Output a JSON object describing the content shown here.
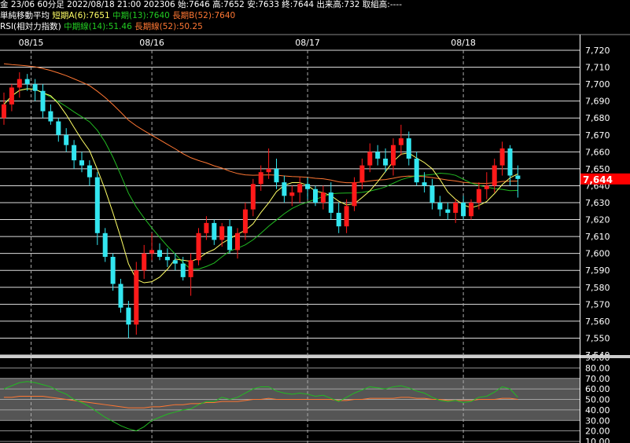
{
  "header": {
    "line1": "金 23/06 60分足 2022/08/18 21:00 202306 始:7646 高:7652 安:7633 終:7644 出来高:732 取組高:----",
    "line2_label": "単純移動平均",
    "ma_short": "短期A(6):7651",
    "ma_mid": "中期(13):7640",
    "ma_long": "長期B(52):7640",
    "line3_label": "RSI(相対力指数)",
    "rsi_mid": "中期線(14):51.46",
    "rsi_long": "長期線(52):50.25"
  },
  "colors": {
    "up": "#ff1a1a",
    "down": "#33e6f0",
    "ma_short": "#ffff66",
    "ma_mid": "#22bb22",
    "ma_long": "#ff7733",
    "last_price_bg": "#ff0000"
  },
  "last_price_label": "7,644",
  "chart_data": [
    {
      "type": "candlestick",
      "x_labels": [
        "08/15",
        "08/16",
        "08/17",
        "08/18"
      ],
      "x_label_index": [
        5,
        19,
        39,
        59
      ],
      "ylim": [
        7540,
        7720
      ],
      "yticks": [
        7540,
        7550,
        7560,
        7570,
        7580,
        7590,
        7600,
        7610,
        7620,
        7630,
        7640,
        7650,
        7660,
        7670,
        7680,
        7690,
        7700,
        7710,
        7720
      ],
      "candles": [
        [
          7680,
          7695,
          7676,
          7688
        ],
        [
          7688,
          7700,
          7684,
          7698
        ],
        [
          7698,
          7707,
          7692,
          7703
        ],
        [
          7703,
          7706,
          7696,
          7700
        ],
        [
          7700,
          7703,
          7690,
          7696
        ],
        [
          7696,
          7700,
          7680,
          7684
        ],
        [
          7684,
          7688,
          7676,
          7678
        ],
        [
          7678,
          7680,
          7666,
          7670
        ],
        [
          7670,
          7674,
          7660,
          7664
        ],
        [
          7664,
          7667,
          7650,
          7655
        ],
        [
          7655,
          7660,
          7648,
          7652
        ],
        [
          7652,
          7655,
          7640,
          7645
        ],
        [
          7645,
          7648,
          7605,
          7612
        ],
        [
          7612,
          7615,
          7595,
          7598
        ],
        [
          7598,
          7600,
          7578,
          7582
        ],
        [
          7582,
          7585,
          7565,
          7568
        ],
        [
          7568,
          7572,
          7550,
          7558
        ],
        [
          7558,
          7595,
          7552,
          7590
        ],
        [
          7590,
          7605,
          7585,
          7600
        ],
        [
          7600,
          7612,
          7596,
          7602
        ],
        [
          7602,
          7606,
          7596,
          7598
        ],
        [
          7598,
          7603,
          7592,
          7596
        ],
        [
          7596,
          7600,
          7590,
          7594
        ],
        [
          7594,
          7598,
          7584,
          7586
        ],
        [
          7586,
          7600,
          7575,
          7596
        ],
        [
          7596,
          7615,
          7593,
          7612
        ],
        [
          7612,
          7622,
          7608,
          7618
        ],
        [
          7618,
          7620,
          7605,
          7608
        ],
        [
          7608,
          7618,
          7604,
          7616
        ],
        [
          7616,
          7620,
          7600,
          7602
        ],
        [
          7602,
          7615,
          7597,
          7612
        ],
        [
          7612,
          7630,
          7608,
          7626
        ],
        [
          7626,
          7644,
          7622,
          7641
        ],
        [
          7641,
          7652,
          7637,
          7648
        ],
        [
          7648,
          7662,
          7644,
          7650
        ],
        [
          7650,
          7656,
          7638,
          7642
        ],
        [
          7642,
          7646,
          7630,
          7634
        ],
        [
          7634,
          7640,
          7628,
          7636
        ],
        [
          7636,
          7645,
          7630,
          7641
        ],
        [
          7641,
          7645,
          7632,
          7638
        ],
        [
          7638,
          7640,
          7628,
          7630
        ],
        [
          7630,
          7640,
          7626,
          7636
        ],
        [
          7636,
          7642,
          7620,
          7624
        ],
        [
          7624,
          7630,
          7612,
          7616
        ],
        [
          7616,
          7632,
          7612,
          7628
        ],
        [
          7628,
          7645,
          7625,
          7642
        ],
        [
          7642,
          7656,
          7638,
          7652
        ],
        [
          7652,
          7665,
          7648,
          7660
        ],
        [
          7660,
          7664,
          7652,
          7656
        ],
        [
          7656,
          7662,
          7648,
          7652
        ],
        [
          7652,
          7668,
          7646,
          7664
        ],
        [
          7664,
          7676,
          7658,
          7668
        ],
        [
          7668,
          7672,
          7652,
          7656
        ],
        [
          7656,
          7660,
          7640,
          7642
        ],
        [
          7642,
          7648,
          7636,
          7640
        ],
        [
          7640,
          7644,
          7626,
          7630
        ],
        [
          7630,
          7634,
          7622,
          7626
        ],
        [
          7626,
          7630,
          7620,
          7624
        ],
        [
          7624,
          7632,
          7618,
          7630
        ],
        [
          7630,
          7634,
          7620,
          7622
        ],
        [
          7622,
          7632,
          7620,
          7630
        ],
        [
          7630,
          7642,
          7626,
          7638
        ],
        [
          7638,
          7648,
          7632,
          7640
        ],
        [
          7640,
          7656,
          7636,
          7652
        ],
        [
          7652,
          7666,
          7646,
          7662
        ],
        [
          7662,
          7664,
          7640,
          7646
        ],
        [
          7646,
          7652,
          7633,
          7644
        ]
      ],
      "ma_short_period": 6,
      "ma_mid_period": 13,
      "ma_long_period": 52
    },
    {
      "type": "line",
      "ylim": [
        10,
        90
      ],
      "yticks": [
        10,
        20,
        30,
        40,
        50,
        60,
        70,
        80,
        90
      ],
      "shade_band": [
        30,
        70
      ],
      "rsi_mid": [
        60,
        63,
        66,
        67,
        66,
        64,
        62,
        58,
        55,
        50,
        47,
        43,
        38,
        33,
        29,
        25,
        22,
        20,
        24,
        30,
        33,
        36,
        38,
        40,
        41,
        45,
        48,
        48,
        52,
        50,
        52,
        56,
        60,
        62,
        62,
        58,
        56,
        55,
        56,
        55,
        53,
        54,
        51,
        48,
        52,
        56,
        59,
        62,
        61,
        60,
        62,
        63,
        61,
        58,
        56,
        52,
        49,
        48,
        49,
        47,
        48,
        52,
        53,
        57,
        62,
        60,
        52
      ],
      "rsi_long": [
        52,
        52,
        53,
        53,
        53,
        53,
        52,
        51,
        50,
        49,
        48,
        47,
        46,
        45,
        44,
        43,
        42,
        42,
        42,
        43,
        43,
        44,
        45,
        45,
        46,
        46,
        47,
        47,
        48,
        48,
        48,
        49,
        50,
        50,
        51,
        50,
        50,
        50,
        50,
        50,
        50,
        50,
        50,
        49,
        49,
        50,
        50,
        51,
        51,
        51,
        51,
        52,
        52,
        51,
        51,
        50,
        50,
        49,
        49,
        49,
        49,
        50,
        50,
        50,
        51,
        51,
        50
      ]
    }
  ]
}
